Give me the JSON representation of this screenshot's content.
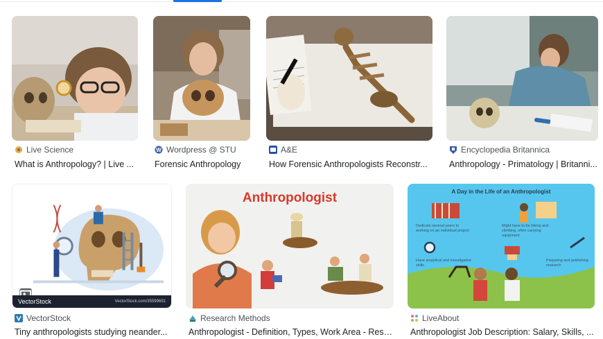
{
  "results": [
    {
      "source": "Live Science",
      "title": "What is Anthropology? | Live ...",
      "favicon": "live-science-favicon-icon",
      "fav_color": "#f4a92b"
    },
    {
      "source": "Wordpress @ STU",
      "title": "Forensic Anthropology",
      "favicon": "wordpress-favicon-icon",
      "fav_color": "#3b5fa6"
    },
    {
      "source": "A&E",
      "title": "How Forensic Anthropologists Reconstr...",
      "favicon": "ae-favicon-icon",
      "fav_color": "#2b4fa8"
    },
    {
      "source": "Encyclopedia Britannica",
      "title": "Anthropology - Primatology | Britanni...",
      "favicon": "britannica-favicon-icon",
      "fav_color": "#3d5aa8"
    },
    {
      "source": "VectorStock",
      "title": "Tiny anthropologists studying neander...",
      "favicon": "vectorstock-favicon-icon",
      "fav_color": "#2a7ab0",
      "watermark": "VectorStock",
      "watermark_url": "VectorStock.com/35599691"
    },
    {
      "source": "Research Methods",
      "title": "Anthropologist - Definition, Types, Work Area - Rese...",
      "favicon": "research-methods-favicon-icon",
      "fav_color": "#4aa0b5",
      "image_heading": "Anthropologist"
    },
    {
      "source": "LiveAbout",
      "title": "Anthropologist Job Description: Salary, Skills, ...",
      "favicon": "liveabout-favicon-icon",
      "fav_color": "#e66aa0",
      "image_heading": "A Day in the Life of an Anthropologist",
      "image_captions": [
        "Dedicate several years to working on an individual project",
        "Might have to be hiking and climbing, often carrying equipment",
        "Have analytical and investigative skills",
        "Preparing and publishing research"
      ]
    }
  ]
}
